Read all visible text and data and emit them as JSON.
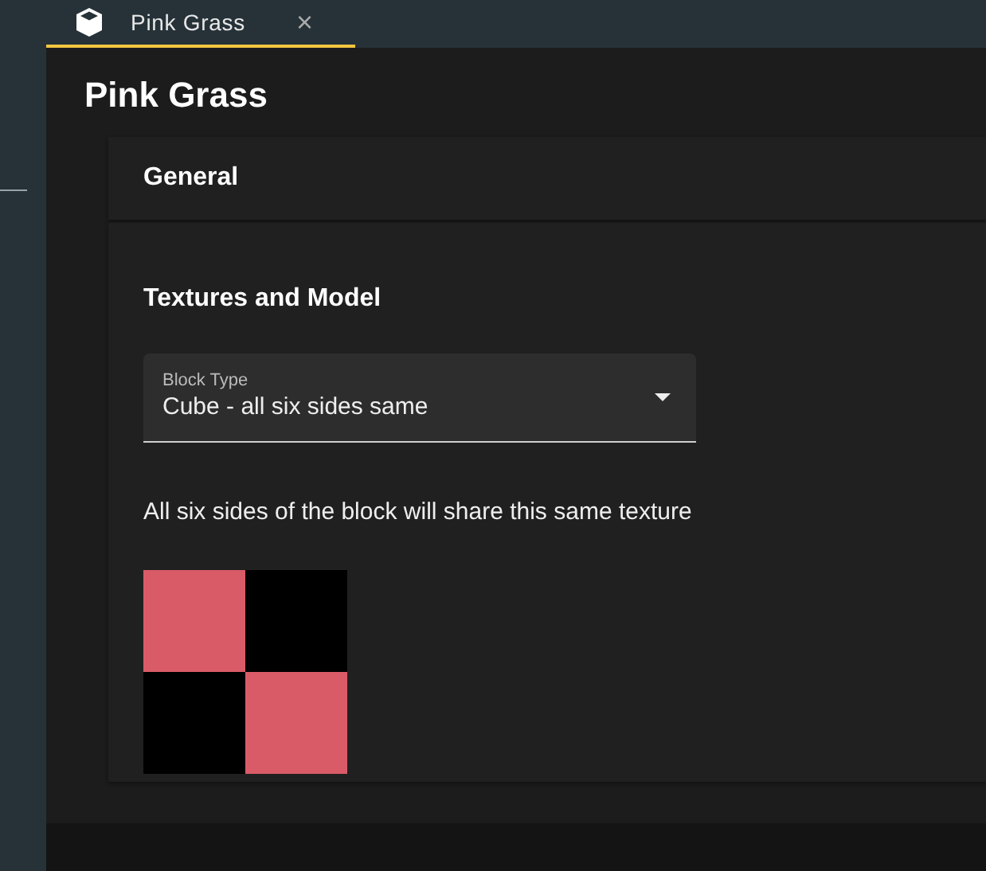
{
  "tabs": [
    {
      "label": "Pink Grass",
      "selected": true,
      "close": "×"
    }
  ],
  "title": "Pink Grass",
  "sections": [
    {
      "heading": "General"
    },
    {
      "heading": "Textures and Model",
      "select": {
        "label": "Block Type",
        "value": "Cube - all six sides same"
      },
      "description": "All six sides of the block will share this same texture"
    }
  ]
}
